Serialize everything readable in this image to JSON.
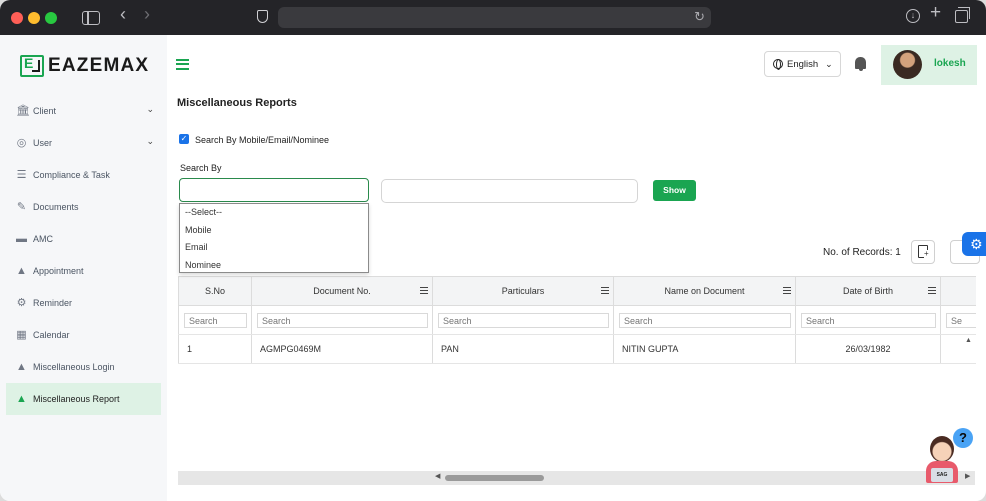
{
  "brand": {
    "name": "EAZEMAX",
    "accent": "#1aa551"
  },
  "sidebar": {
    "items": [
      {
        "label": "Client",
        "icon": "bank-icon",
        "expandable": true
      },
      {
        "label": "User",
        "icon": "user-circle-icon",
        "expandable": true
      },
      {
        "label": "Compliance & Task",
        "icon": "checklist-icon"
      },
      {
        "label": "Documents",
        "icon": "document-edit-icon"
      },
      {
        "label": "AMC",
        "icon": "card-icon"
      },
      {
        "label": "Appointment",
        "icon": "person-icon"
      },
      {
        "label": "Reminder",
        "icon": "gear-icon"
      },
      {
        "label": "Calendar",
        "icon": "calendar-icon"
      },
      {
        "label": "Miscellaneous Login",
        "icon": "person-icon"
      },
      {
        "label": "Miscellaneous Report",
        "icon": "person-icon",
        "active": true
      }
    ]
  },
  "header": {
    "language": "English",
    "user_name": "lokesh"
  },
  "page": {
    "title": "Miscellaneous Reports",
    "search_by_checkbox_label": "Search By Mobile/Email/Nominee",
    "search_by_label": "Search By",
    "show_label": "Show",
    "dropdown_options": [
      "--Select--",
      "Mobile",
      "Email",
      "Nominee"
    ],
    "records_label": "No. of Records: 1"
  },
  "grid": {
    "columns": [
      "S.No",
      "Document No.",
      "Particulars",
      "Name on Document",
      "Date of Birth",
      ""
    ],
    "filter_placeholder": "Search",
    "filter_placeholder_partial": "Se",
    "rows": [
      {
        "sno": "1",
        "document_no": "AGMPG0469M",
        "particulars": "PAN",
        "name_on_document": "NITIN GUPTA",
        "dob": "26/03/1982"
      }
    ]
  },
  "help_widget": {
    "question_mark": "?",
    "laptop_text": "SAG"
  }
}
